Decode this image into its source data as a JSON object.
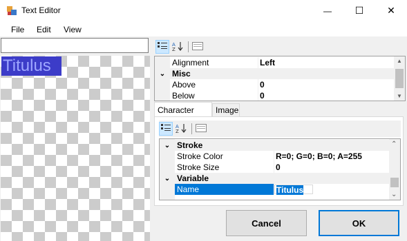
{
  "window": {
    "title": "Text Editor",
    "controls": {
      "minimize": "—",
      "maximize": "☐",
      "close": "✕"
    }
  },
  "menu": {
    "items": [
      "File",
      "Edit",
      "View"
    ]
  },
  "left": {
    "text_input_value": "",
    "canvas_text": "Titulus"
  },
  "top_grid": {
    "rows": [
      {
        "type": "prop",
        "name": "Alignment",
        "value": "Left"
      },
      {
        "type": "category",
        "name": "Misc",
        "glyph": "⌄"
      },
      {
        "type": "prop",
        "name": "Above",
        "value": "0"
      },
      {
        "type": "prop",
        "name": "Below",
        "value": "0"
      }
    ]
  },
  "tabs": {
    "items": [
      "Character Style",
      "Image"
    ],
    "active": 0
  },
  "style_grid": {
    "rows": [
      {
        "type": "category",
        "name": "Stroke",
        "glyph": "⌄"
      },
      {
        "type": "prop",
        "name": "Stroke Color",
        "value": "R=0; G=0; B=0; A=255"
      },
      {
        "type": "prop",
        "name": "Stroke Size",
        "value": "0"
      },
      {
        "type": "category",
        "name": "Variable",
        "glyph": "⌄"
      },
      {
        "type": "prop",
        "name": "Name",
        "value": "Titulus",
        "selected": true
      }
    ]
  },
  "buttons": {
    "cancel": "Cancel",
    "ok": "OK"
  },
  "colors": {
    "selection": "#0078d7",
    "canvas_text_bg": "#3c3cc8",
    "canvas_text_fg": "#9ea6ff"
  },
  "icons": {
    "categorized": "categorized-icon",
    "alphabetical": "sort-alphabetical-icon",
    "property_pages": "property-pages-icon"
  }
}
